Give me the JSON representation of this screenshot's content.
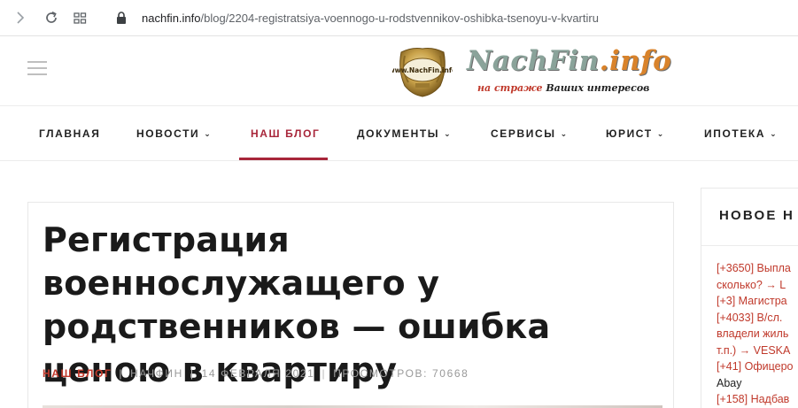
{
  "browser": {
    "url_domain": "nachfin.info",
    "url_path": "/blog/2204-registratsiya-voennogo-u-rodstvennikov-oshibka-tsenoyu-v-kvartiru"
  },
  "site": {
    "emblem_text": "www.NachFin.info",
    "logo_name": "NachFin",
    "logo_suffix": ".info",
    "tagline_red": "на страже",
    "tagline_dark": "Ваших интересов"
  },
  "nav": {
    "items": [
      {
        "label": "ГЛАВНАЯ",
        "has_dropdown": false
      },
      {
        "label": "НОВОСТИ",
        "has_dropdown": true
      },
      {
        "label": "НАШ БЛОГ",
        "has_dropdown": false,
        "active": true
      },
      {
        "label": "ДОКУМЕНТЫ",
        "has_dropdown": true
      },
      {
        "label": "СЕРВИСЫ",
        "has_dropdown": true
      },
      {
        "label": "ЮРИСТ",
        "has_dropdown": true
      },
      {
        "label": "ИПОТЕКА",
        "has_dropdown": true
      }
    ],
    "dropdown_glyph": "⌄",
    "active_color": "#a8263a"
  },
  "article": {
    "title": "Регистрация военнослужащего у родственников — ошибка ценою в квартиру",
    "category": "НАШ БЛОГ",
    "author": "НАЧФИН",
    "date": "14 ФЕВРАЛЯ 2021",
    "views": "ПРОСМОТРОВ: 70668",
    "separator": "|"
  },
  "sidebar": {
    "title": "НОВОЕ Н",
    "lines": [
      {
        "text": "[+3650] Выпла",
        "style": "red"
      },
      {
        "text": "сколько? → L",
        "style": "red"
      },
      {
        "text": "[+3] Магистра",
        "style": "red"
      },
      {
        "text": "[+4033] В/сл.",
        "style": "red"
      },
      {
        "text": "владели жиль",
        "style": "red"
      },
      {
        "text": "т.п.) → VESKA",
        "style": "red"
      },
      {
        "text": "[+41] Офицеро",
        "style": "red"
      },
      {
        "text": "Abay",
        "style": "dark"
      },
      {
        "text": "[+158] Надбав",
        "style": "red"
      }
    ]
  },
  "icons": [
    "forward-arrow-icon",
    "reload-icon",
    "tabs-grid-icon",
    "lock-icon",
    "hamburger-menu-icon",
    "chevron-down-icon"
  ]
}
